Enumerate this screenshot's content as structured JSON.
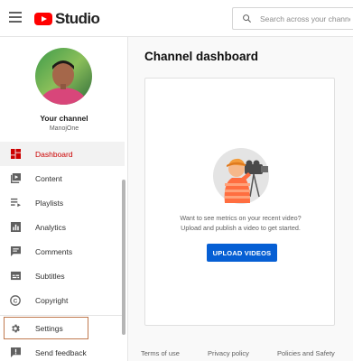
{
  "header": {
    "logo_text": "Studio",
    "search_placeholder": "Search across your channel"
  },
  "sidebar": {
    "channel_title": "Your channel",
    "channel_name": "ManojOne",
    "items": [
      {
        "label": "Dashboard",
        "icon": "dashboard-icon"
      },
      {
        "label": "Content",
        "icon": "content-icon"
      },
      {
        "label": "Playlists",
        "icon": "playlists-icon"
      },
      {
        "label": "Analytics",
        "icon": "analytics-icon"
      },
      {
        "label": "Comments",
        "icon": "comments-icon"
      },
      {
        "label": "Subtitles",
        "icon": "subtitles-icon"
      },
      {
        "label": "Copyright",
        "icon": "copyright-icon"
      },
      {
        "label": "Settings",
        "icon": "gear-icon"
      },
      {
        "label": "Send feedback",
        "icon": "feedback-icon"
      }
    ]
  },
  "main": {
    "title": "Channel dashboard",
    "prompt_line1": "Want to see metrics on your recent video?",
    "prompt_line2": "Upload and publish a video to get started.",
    "upload_label": "UPLOAD VIDEOS"
  },
  "footer": {
    "terms": "Terms of use",
    "privacy": "Privacy policy",
    "policies": "Policies and Safety"
  },
  "colors": {
    "accent": "#065fd4",
    "active": "#cc0000",
    "brand": "#ff0000"
  }
}
